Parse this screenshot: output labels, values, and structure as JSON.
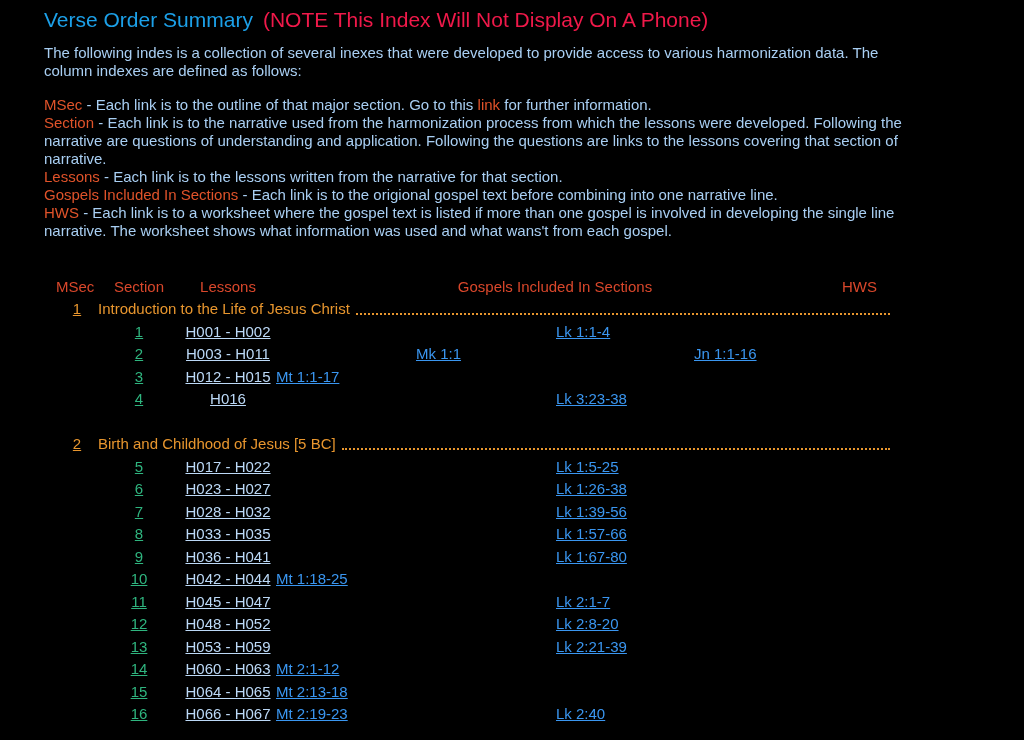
{
  "title": "Verse Order Summary",
  "note": "(NOTE This Index Will Not Display On A Phone)",
  "intro": "The following indes is a collection of several inexes that were developed to provide access to various harmonization data. The column indexes are defined as follows:",
  "definitions": [
    {
      "term": "MSec",
      "text": " - Each link is to the outline of that major section. Go to this ",
      "link": "link",
      "after": " for further information."
    },
    {
      "term": "Section",
      "text": " - Each link is to the narrative used from the harmonization process from which the lessons were developed. Following the narrative are questions of understanding and application. Following the questions are links to the lessons covering that section of narrative."
    },
    {
      "term": "Lessons",
      "text": " - Each link is to the lessons written from the narrative for that section."
    },
    {
      "term": "Gospels Included In Sections",
      "text": " - Each link is to the origional gospel text before combining into one narrative line."
    },
    {
      "term": "HWS",
      "text": " - Each link is to a worksheet where the gospel text is listed if more than one gospel is involved in developing the single line narrative. The worksheet shows what information was used and what wans't from each gospel."
    }
  ],
  "table": {
    "columns": {
      "msec": "MSec",
      "section": "Section",
      "lessons": "Lessons",
      "gospels": "Gospels Included In Sections",
      "hws": "HWS"
    },
    "groups": [
      {
        "number": "1",
        "title": "Introduction to the Life of Jesus Christ",
        "rows": [
          {
            "section": "1",
            "lessons": "H001 - H002",
            "lk": "Lk 1:1-4"
          },
          {
            "section": "2",
            "lessons": "H003 - H011",
            "mk": "Mk 1:1",
            "jn": "Jn 1:1-16"
          },
          {
            "section": "3",
            "lessons": "H012 - H015",
            "mt": "Mt 1:1-17"
          },
          {
            "section": "4",
            "lessons": "H016",
            "lk": "Lk 3:23-38"
          }
        ]
      },
      {
        "number": "2",
        "title": "Birth and Childhood of Jesus [5 BC]",
        "rows": [
          {
            "section": "5",
            "lessons": "H017 - H022",
            "lk": "Lk 1:5-25"
          },
          {
            "section": "6",
            "lessons": "H023 - H027",
            "lk": "Lk 1:26-38"
          },
          {
            "section": "7",
            "lessons": "H028 - H032",
            "lk": "Lk 1:39-56"
          },
          {
            "section": "8",
            "lessons": "H033 - H035",
            "lk": "Lk 1:57-66"
          },
          {
            "section": "9",
            "lessons": "H036 - H041",
            "lk": "Lk 1:67-80"
          },
          {
            "section": "10",
            "lessons": "H042 - H044",
            "mt": "Mt 1:18-25"
          },
          {
            "section": "11",
            "lessons": "H045 - H047",
            "lk": "Lk 2:1-7"
          },
          {
            "section": "12",
            "lessons": "H048 - H052",
            "lk": "Lk 2:8-20"
          },
          {
            "section": "13",
            "lessons": "H053 - H059",
            "lk": "Lk 2:21-39"
          },
          {
            "section": "14",
            "lessons": "H060 - H063",
            "mt": "Mt 2:1-12"
          },
          {
            "section": "15",
            "lessons": "H064 - H065",
            "mt": "Mt 2:13-18"
          },
          {
            "section": "16",
            "lessons": "H066 - H067",
            "mt": "Mt 2:19-23",
            "lk": "Lk 2:40"
          }
        ]
      }
    ]
  }
}
